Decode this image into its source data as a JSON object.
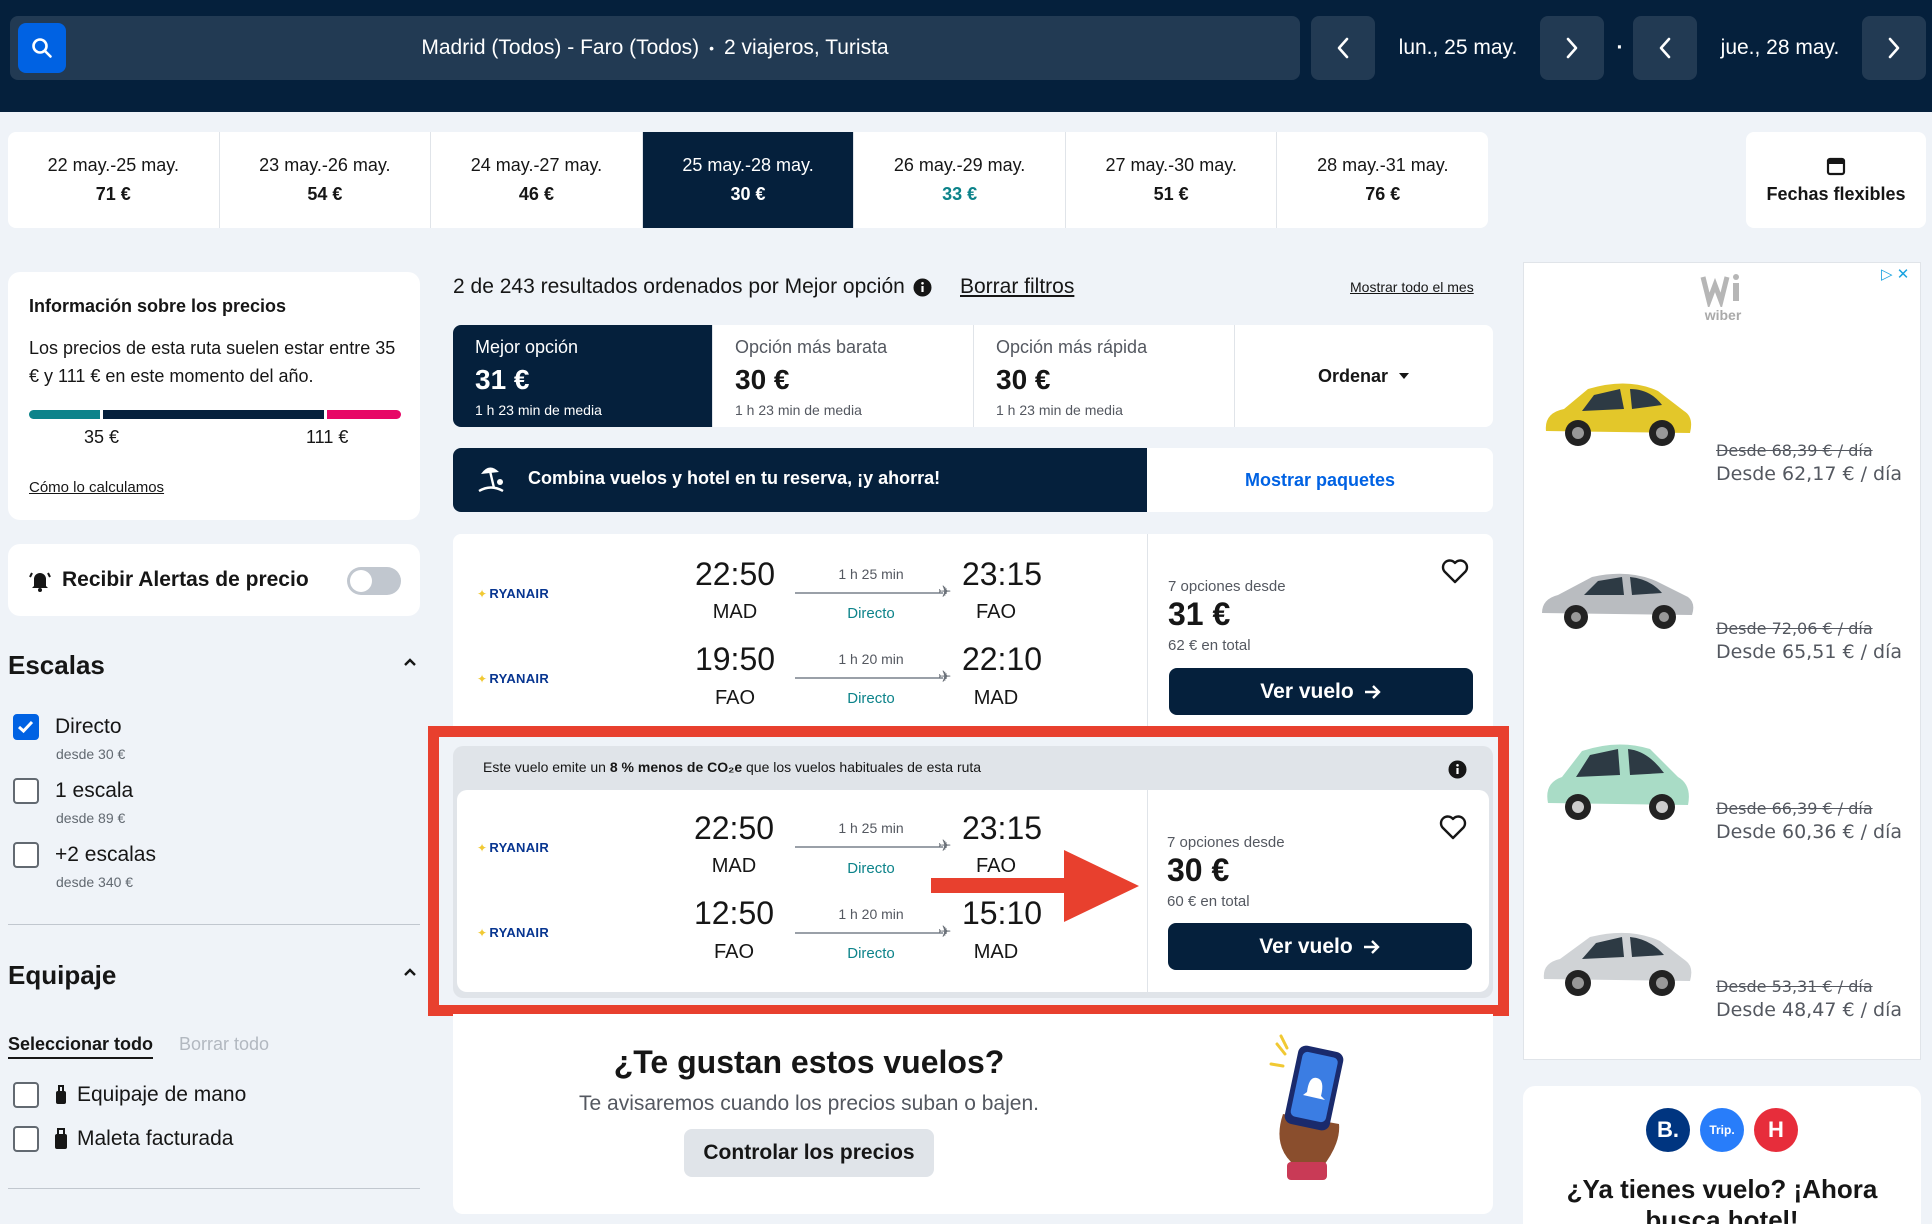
{
  "header": {
    "search_summary": "Madrid (Todos) - Faro (Todos)",
    "separator": "•",
    "travellers": "2 viajeros, Turista",
    "depart_date": "lun., 25 may.",
    "return_date": "jue., 28 may.",
    "date_separator": "·"
  },
  "date_tabs": [
    {
      "dates": "22 may.-25 may.",
      "price": "71 €"
    },
    {
      "dates": "23 may.-26 may.",
      "price": "54 €"
    },
    {
      "dates": "24 may.-27 may.",
      "price": "46 €"
    },
    {
      "dates": "25 may.-28 may.",
      "price": "30 €"
    },
    {
      "dates": "26 may.-29 may.",
      "price": "33 €"
    },
    {
      "dates": "27 may.-30 may.",
      "price": "51 €"
    },
    {
      "dates": "28 may.-31 may.",
      "price": "76 €"
    }
  ],
  "flexible_dates": "Fechas flexibles",
  "price_info": {
    "title": "Información sobre los precios",
    "text": "Los precios de esta ruta suelen estar entre 35 € y 111 € en este momento del año.",
    "low": "35 €",
    "high": "111 €",
    "low_fraction": 0.2,
    "high_fraction": 0.8,
    "link": "Cómo lo calculamos",
    "colors": {
      "low": "#0c838a",
      "typical": "#05203c",
      "high": "#e70866"
    }
  },
  "alerts": {
    "label": "Recibir Alertas de precio",
    "enabled": false
  },
  "stops": {
    "title": "Escalas",
    "options": [
      {
        "label": "Directo",
        "from": "desde 30 €",
        "checked": true
      },
      {
        "label": "1 escala",
        "from": "desde 89 €",
        "checked": false
      },
      {
        "label": "+2 escalas",
        "from": "desde 340 €",
        "checked": false
      }
    ]
  },
  "baggage": {
    "title": "Equipaje",
    "select_all": "Seleccionar todo",
    "clear_all": "Borrar todo",
    "options": [
      {
        "label": "Equipaje de mano"
      },
      {
        "label": "Maleta facturada"
      }
    ]
  },
  "results": {
    "summary": "2 de 243 resultados ordenados por Mejor opción",
    "clear_filters": "Borrar filtros",
    "show_month": "Mostrar todo el mes"
  },
  "sort_tabs": [
    {
      "label": "Mejor opción",
      "price": "31 €",
      "duration": "1 h 23 min de media"
    },
    {
      "label": "Opción más barata",
      "price": "30 €",
      "duration": "1 h 23 min de media"
    },
    {
      "label": "Opción más rápida",
      "price": "30 €",
      "duration": "1 h 23 min de media"
    }
  ],
  "sort_menu": "Ordenar",
  "promo": {
    "text": "Combina vuelos y hotel en tu reserva, ¡y ahorra!",
    "cta": "Mostrar paquetes"
  },
  "flights": [
    {
      "legs": [
        {
          "airline": "RYANAIR",
          "dep_time": "22:50",
          "dep_code": "MAD",
          "duration": "1 h 25 min",
          "type": "Directo",
          "arr_time": "23:15",
          "arr_code": "FAO"
        },
        {
          "airline": "RYANAIR",
          "dep_time": "19:50",
          "dep_code": "FAO",
          "duration": "1 h 20 min",
          "type": "Directo",
          "arr_time": "22:10",
          "arr_code": "MAD"
        }
      ],
      "options": "7 opciones desde",
      "price": "31 €",
      "total": "62 € en total",
      "cta": "Ver vuelo"
    },
    {
      "eco_pre": "Este vuelo emite un ",
      "eco_bold": "8 % menos de CO₂e",
      "eco_post": " que los vuelos habituales de esta ruta",
      "legs": [
        {
          "airline": "RYANAIR",
          "dep_time": "22:50",
          "dep_code": "MAD",
          "duration": "1 h 25 min",
          "type": "Directo",
          "arr_time": "23:15",
          "arr_code": "FAO"
        },
        {
          "airline": "RYANAIR",
          "dep_time": "12:50",
          "dep_code": "FAO",
          "duration": "1 h 20 min",
          "type": "Directo",
          "arr_time": "15:10",
          "arr_code": "MAD"
        }
      ],
      "options": "7 opciones desde",
      "price": "30 €",
      "total": "60 € en total",
      "cta": "Ver vuelo"
    }
  ],
  "price_alert_promo": {
    "title": "¿Te gustan estos vuelos?",
    "text": "Te avisaremos cuando los precios suban o bajen.",
    "button": "Controlar los precios"
  },
  "ad": {
    "brand": "wiber",
    "cars": [
      {
        "old": "Desde 68,39 € / día",
        "new": "Desde 62,17 € / día",
        "color": "#e3c72a"
      },
      {
        "old": "Desde 72,06 € / día",
        "new": "Desde 65,51 € / día",
        "color": "#b9bcc0"
      },
      {
        "old": "Desde 66,39 € / día",
        "new": "Desde 60,36 € / día",
        "color": "#a9dcc6"
      },
      {
        "old": "Desde 53,31 € / día",
        "new": "Desde 48,47 € / día",
        "color": "#d0d3d6"
      }
    ]
  },
  "hotel_promo": {
    "title": "¿Ya tienes vuelo? ¡Ahora busca hotel!",
    "logos": [
      {
        "text": "B.",
        "color": "#003580"
      },
      {
        "text": "Trip.",
        "color": "#287dfa"
      },
      {
        "text": "H",
        "color": "#e72d3b"
      }
    ]
  },
  "highlight_color": "#e8402e"
}
